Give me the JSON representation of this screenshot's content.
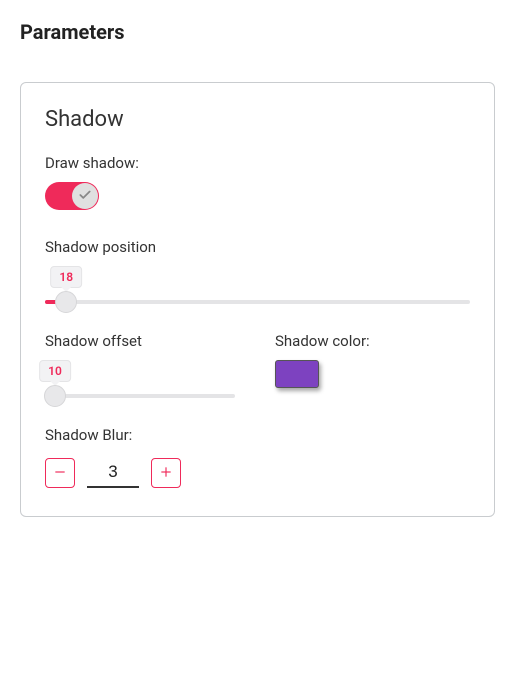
{
  "page": {
    "title": "Parameters"
  },
  "panel": {
    "title": "Shadow"
  },
  "fields": {
    "draw_shadow": {
      "label": "Draw shadow:",
      "value": true
    },
    "shadow_position": {
      "label": "Shadow position",
      "value": 18,
      "min": 0,
      "max": 360,
      "percent": 5
    },
    "shadow_offset": {
      "label": "Shadow offset",
      "value": 10,
      "min": 0,
      "max": 200,
      "percent": 5
    },
    "shadow_color": {
      "label": "Shadow color:",
      "value": "#7d42c0"
    },
    "shadow_blur": {
      "label": "Shadow Blur:",
      "value": 3
    }
  }
}
